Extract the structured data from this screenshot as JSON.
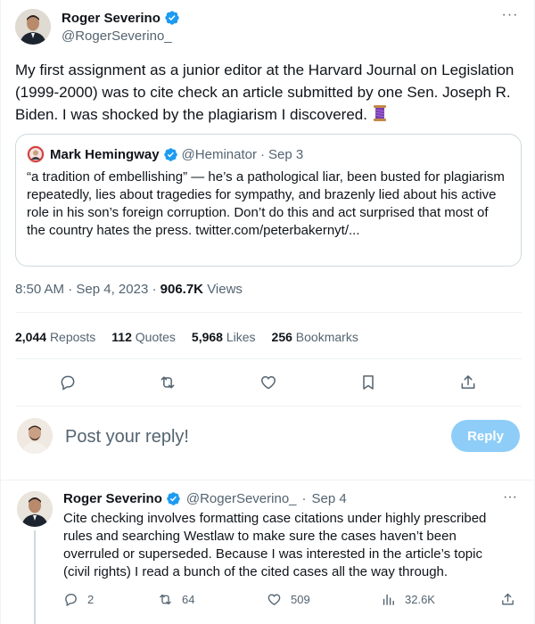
{
  "tweet": {
    "author": {
      "name": "Roger Severino",
      "handle": "@RogerSeverino_",
      "verified": true
    },
    "text": "My first assignment as a junior editor at the Harvard Journal on Legislation (1999-2000) was to cite check an article submitted by one Sen. Joseph R. Biden. I was shocked by the plagiarism I discovered.",
    "emoji": "spool-of-thread-icon",
    "quote": {
      "name": "Mark Hemingway",
      "handle": "@Heminator",
      "date": "Sep 3",
      "text": "“a tradition of embellishing” — he’s a pathological liar, been busted for plagiarism repeatedly, lies about tragedies for sympathy, and brazenly lied about his active role in his son’s foreign corruption. Don’t do this and act surprised that most of the country hates the press. twitter.com/peterbakernyt/..."
    },
    "time": "8:50 AM",
    "date": "Sep 4, 2023",
    "views_count": "906.7K",
    "views_label": "Views",
    "stats": {
      "reposts": "2,044",
      "reposts_label": "Reposts",
      "quotes": "112",
      "quotes_label": "Quotes",
      "likes": "5,968",
      "likes_label": "Likes",
      "bookmarks": "256",
      "bookmarks_label": "Bookmarks"
    }
  },
  "composer": {
    "placeholder": "Post your reply!",
    "button_label": "Reply"
  },
  "reply": {
    "name": "Roger Severino",
    "handle": "@RogerSeverino_",
    "date": "Sep 4",
    "text": "Cite checking involves formatting case citations under highly prescribed rules and searching Westlaw to make sure the cases haven’t been overruled or superseded. Because I was interested in the article’s topic (civil rights) I read a bunch of the cited cases all the way through.",
    "replies": "2",
    "reposts": "64",
    "likes": "509",
    "views": "32.6K"
  },
  "colors": {
    "text": "#0f1419",
    "secondary": "#536471",
    "accent": "#1d9bf0",
    "reply_button_disabled": "#8ecdf8",
    "border": "#cfd9de"
  }
}
